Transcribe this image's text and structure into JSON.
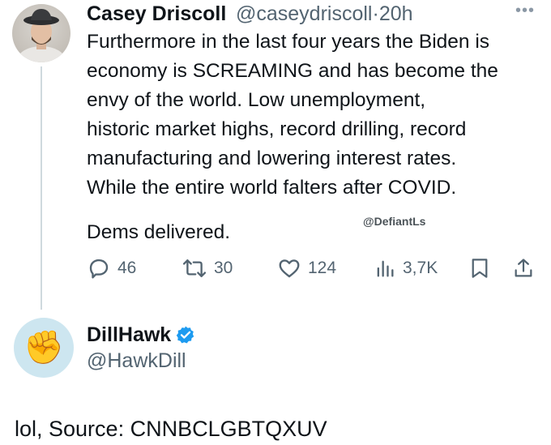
{
  "tweet": {
    "author": {
      "name": "Casey Driscoll",
      "handle": "@caseydriscoll",
      "separator": "·",
      "time": "20h"
    },
    "body_lines": [
      "Furthermore in the last four years the Biden is",
      "economy is SCREAMING and has become the",
      "envy of the world. Low unemployment,",
      "historic market highs, record drilling, record",
      "manufacturing and lowering interest rates.",
      "While the entire world falters after COVID."
    ],
    "closing_line": "Dems delivered.",
    "watermark": "@DefiantLs",
    "actions": {
      "replies": "46",
      "retweets": "30",
      "likes": "124",
      "views": "3,7K"
    }
  },
  "reply_author": {
    "name": "DillHawk",
    "handle": "@HawkDill",
    "verified": true,
    "avatar_emoji": "✊"
  },
  "reply_text": "lol, Source: CNNBCLGBTQXUV",
  "colors": {
    "text": "#0f1419",
    "secondary": "#536471",
    "verified": "#1d9bf0",
    "thread_line": "#cfd9de",
    "avatar2_bg": "#cde6f0"
  }
}
